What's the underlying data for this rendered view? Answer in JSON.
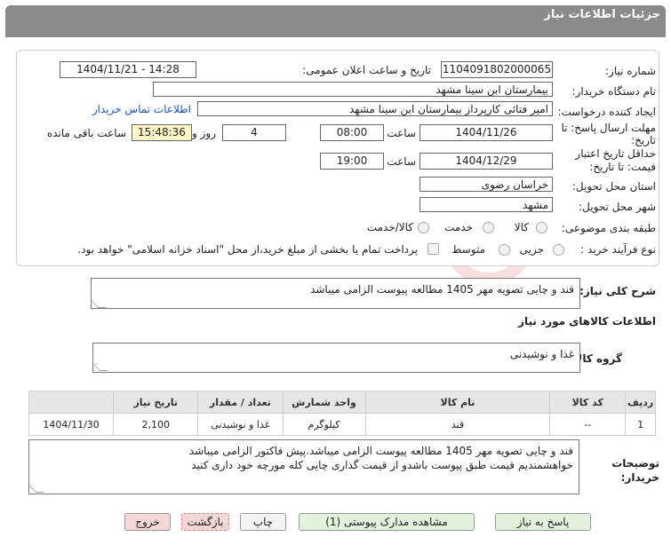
{
  "header": {
    "title": "جزئیات اطلاعات نیاز"
  },
  "form": {
    "need_number_label": "شماره نیاز:",
    "need_number": "1104091802000065",
    "announce_label": "تاریخ و ساعت اعلان عمومی:",
    "announce_value": "1404/11/21 - 14:28",
    "buyer_org_label": "نام دستگاه خریدار:",
    "buyer_org": "بیمارستان ابن سینا مشهد",
    "creator_label": "ایجاد کننده درخواست:",
    "creator": "امیر فتائی کارپرداز بیمارستان ابن سینا مشهد",
    "contact_link": "اطلاعات تماس خریدار",
    "deadline_label_1": "مهلت ارسال پاسخ: تا",
    "deadline_label_2": "تاریخ:",
    "deadline_date": "1404/11/26",
    "time_label": "ساعت",
    "deadline_time": "08:00",
    "days_value": "4",
    "days_label": "روز و",
    "remaining_time": "15:48:36",
    "remaining_label": "ساعت باقی مانده",
    "validity_label_1": "حداقل تاریخ اعتبار",
    "validity_label_2": "قیمت: تا تاریخ:",
    "validity_date": "1404/12/29",
    "validity_time": "19:00",
    "province_label": "استان محل تحویل:",
    "province": "خراسان رضوی",
    "city_label": "شهر محل تحویل:",
    "city": "مشهد",
    "category_label": "طبقه بندی موضوعی:",
    "category_options": [
      "کالا",
      "خدمت",
      "کالا/خدمت"
    ],
    "process_label": "نوع فرآیند خرید :",
    "process_options": [
      "جزیی",
      "متوسط"
    ],
    "payment_note": "پرداخت تمام یا بخشی از مبلغ خرید،از محل \"اسناد خزانه اسلامی\" خواهد بود."
  },
  "summary": {
    "label": "شرح کلی نیاز:",
    "value": "قند و چایی تصویه مهر 1405 مطالعه پیوست الزامی میباشد"
  },
  "goods": {
    "section_title": "اطلاعات کالاهای مورد نیاز",
    "group_label": "گروه کالا:",
    "group_value": "غذا و نوشیدنی",
    "columns": [
      "ردیف",
      "کد کالا",
      "نام کالا",
      "واحد شمارش",
      "تعداد / مقدار",
      "تاریخ نیاز"
    ],
    "rows": [
      [
        "1",
        "--",
        "قند",
        "کیلوگرم",
        "2,100",
        "1404/11/30"
      ]
    ],
    "row_group": "غذا و نوشیدنی"
  },
  "notes": {
    "label_1": "توضیحات",
    "label_2": "خریدار:",
    "line1": "قند و چایی تصویه مهر 1405 مطالعه پیوست الزامی میباشد.پیش فاکتور الزامی میباشد",
    "line2": "خواهشمندیم قیمت طبق پیوست باشدو از قیمت گذاری چایی کله مورچه خود داری کنید"
  },
  "buttons": {
    "reply": "پاسخ به نیاز",
    "attachments": "مشاهده مدارک پیوستی (1)",
    "print": "چاپ",
    "back": "بازگشت",
    "exit": "خروج"
  },
  "colors": {
    "header_bg": "#8a8a8a",
    "link": "#1a56c8",
    "remaining_bg": "#fdf6c6",
    "back_exit_bg": "#f6d6d6",
    "reply_bg": "#e3f2dc"
  }
}
